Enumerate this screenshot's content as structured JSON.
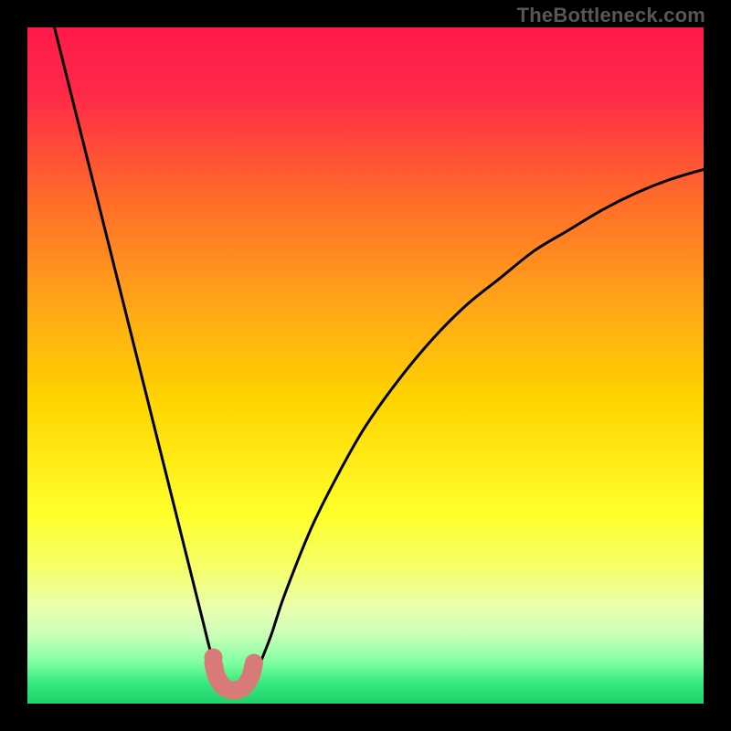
{
  "watermark": "TheBottleneck.com",
  "chart_data": {
    "type": "line",
    "title": "",
    "xlabel": "",
    "ylabel": "",
    "xlim": [
      0,
      100
    ],
    "ylim": [
      0,
      100
    ],
    "series": [
      {
        "name": "bottleneck-curve",
        "x": [
          4,
          6,
          8,
          10,
          12,
          14,
          16,
          18,
          20,
          22,
          24,
          26,
          27,
          28,
          29,
          30,
          31,
          32,
          33,
          34,
          36,
          38,
          42,
          46,
          50,
          55,
          60,
          65,
          70,
          75,
          80,
          85,
          90,
          95,
          100
        ],
        "y": [
          100,
          92,
          84,
          76,
          68,
          60,
          52,
          44,
          36,
          28,
          20,
          12,
          8,
          5,
          3,
          2,
          2,
          2,
          3,
          5,
          10,
          16,
          26,
          34,
          41,
          48,
          54,
          59,
          63,
          67,
          70,
          73,
          75.5,
          77.5,
          79
        ]
      },
      {
        "name": "highlight-segment",
        "x": [
          27.5,
          28,
          29,
          30,
          31,
          32,
          33,
          33.5
        ],
        "y": [
          6,
          4,
          2.5,
          2,
          2,
          2.5,
          4,
          6
        ]
      }
    ],
    "gradient_stops": [
      {
        "offset": 0.0,
        "color": "#ff1a4b"
      },
      {
        "offset": 0.1,
        "color": "#ff2a48"
      },
      {
        "offset": 0.25,
        "color": "#ff6a2a"
      },
      {
        "offset": 0.4,
        "color": "#ffa21a"
      },
      {
        "offset": 0.55,
        "color": "#ffd400"
      },
      {
        "offset": 0.72,
        "color": "#ffff2a"
      },
      {
        "offset": 0.8,
        "color": "#f6ff6a"
      },
      {
        "offset": 0.86,
        "color": "#eaffb0"
      },
      {
        "offset": 0.9,
        "color": "#c8ffb8"
      },
      {
        "offset": 0.94,
        "color": "#7dff9e"
      },
      {
        "offset": 0.97,
        "color": "#35e97d"
      },
      {
        "offset": 1.0,
        "color": "#1fd36a"
      }
    ],
    "colors": {
      "curve": "#000000",
      "highlight": "#d87a78",
      "frame": "#000000"
    }
  }
}
